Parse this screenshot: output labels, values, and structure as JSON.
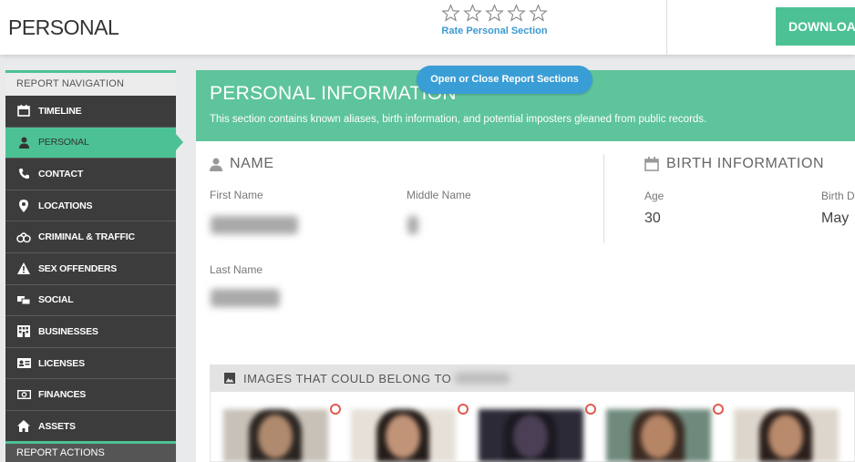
{
  "header": {
    "page_title": "PERSONAL",
    "rate_label": "Rate Personal Section",
    "star_count": 5,
    "download_label": "DOWNLOAD"
  },
  "sidebar": {
    "header": "REPORT NAVIGATION",
    "items": [
      {
        "label": "TIMELINE",
        "icon": "calendar-icon"
      },
      {
        "label": "PERSONAL",
        "icon": "person-icon",
        "active": true
      },
      {
        "label": "CONTACT",
        "icon": "phone-icon"
      },
      {
        "label": "LOCATIONS",
        "icon": "map-pin-icon"
      },
      {
        "label": "CRIMINAL & TRAFFIC",
        "icon": "handcuffs-icon"
      },
      {
        "label": "SEX OFFENDERS",
        "icon": "warning-icon"
      },
      {
        "label": "SOCIAL",
        "icon": "social-icon"
      },
      {
        "label": "BUSINESSES",
        "icon": "building-icon"
      },
      {
        "label": "LICENSES",
        "icon": "id-card-icon"
      },
      {
        "label": "FINANCES",
        "icon": "money-icon"
      },
      {
        "label": "ASSETS",
        "icon": "home-icon"
      }
    ],
    "footer": "REPORT ACTIONS"
  },
  "section": {
    "toggle_label": "Open or Close Report Sections",
    "title": "PERSONAL INFORMATION",
    "description": "This section contains known aliases, birth information, and potential imposters gleaned from public records.",
    "name_heading": "NAME",
    "first_name_label": "First Name",
    "middle_name_label": "Middle Name",
    "last_name_label": "Last Name",
    "birth_heading": "BIRTH INFORMATION",
    "age_label": "Age",
    "age_value": "30",
    "birth_date_label": "Birth D",
    "birth_date_value": "May",
    "images_heading": "IMAGES THAT COULD BELONG TO"
  },
  "colors": {
    "accent_green": "#4cc294",
    "banner_green": "#5ec49b",
    "toggle_blue": "#3a9ed6",
    "sidebar_dark": "#3c3c3c"
  }
}
